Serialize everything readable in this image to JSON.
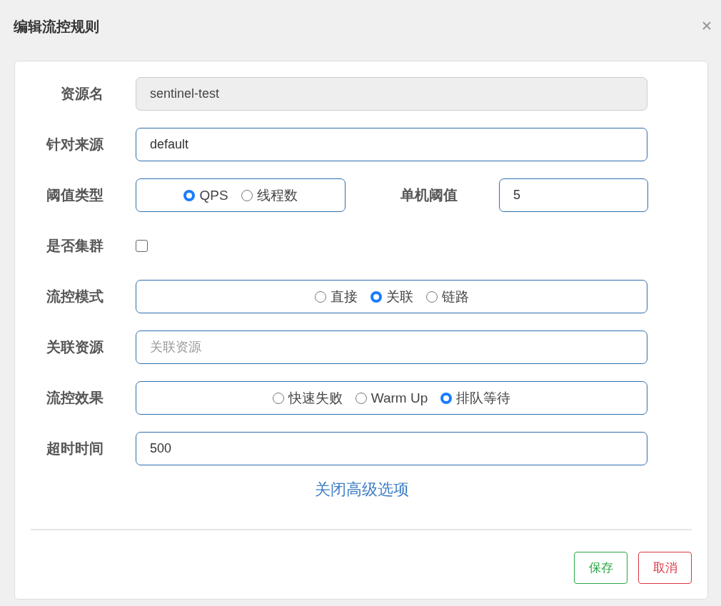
{
  "window": {
    "title": "编辑流控规则"
  },
  "fields": [
    {
      "kind": "text",
      "label": "资源名",
      "value": "sentinel-test",
      "disabled": true
    },
    {
      "kind": "text",
      "label": "针对来源",
      "value": "default",
      "disabled": false
    },
    {
      "kind": "radio-pair",
      "label": "阈值类型",
      "options": [
        {
          "label": "QPS",
          "selected": true
        },
        {
          "label": "线程数",
          "selected": false
        }
      ],
      "side_label": "单机阈值",
      "side_value": "5"
    },
    {
      "kind": "checkbox",
      "label": "是否集群",
      "checked": false
    },
    {
      "kind": "radio",
      "label": "流控模式",
      "options": [
        {
          "label": "直接",
          "selected": false
        },
        {
          "label": "关联",
          "selected": true
        },
        {
          "label": "链路",
          "selected": false
        }
      ]
    },
    {
      "kind": "text",
      "label": "关联资源",
      "placeholder": "关联资源",
      "disabled": false
    },
    {
      "kind": "radio",
      "label": "流控效果",
      "options": [
        {
          "label": "快速失败",
          "selected": false
        },
        {
          "label": "Warm Up",
          "selected": false
        },
        {
          "label": "排队等待",
          "selected": true
        }
      ]
    },
    {
      "kind": "text",
      "label": "超时时间",
      "value": "500",
      "disabled": false
    }
  ],
  "advanced_link": "关闭高级选项",
  "buttons": [
    {
      "label": "保存",
      "kind": "success"
    },
    {
      "label": "取消",
      "kind": "danger"
    }
  ]
}
